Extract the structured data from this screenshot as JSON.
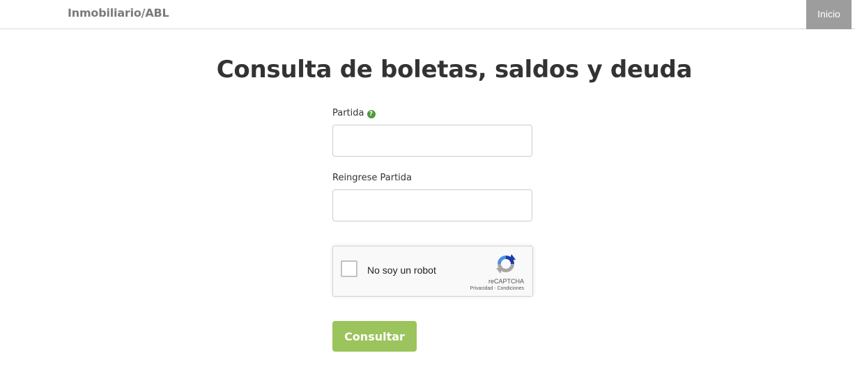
{
  "header": {
    "brand": "Inmobiliario/ABL",
    "nav_inicio": "Inicio"
  },
  "main": {
    "title": "Consulta de boletas, saldos y deuda",
    "partida_label": "Partida",
    "partida_value": "",
    "reingrese_label": "Reingrese Partida",
    "reingrese_value": "",
    "submit_label": "Consultar"
  },
  "recaptcha": {
    "label": "No soy un robot",
    "brand": "reCAPTCHA",
    "privacy": "Privacidad",
    "separator": " - ",
    "terms": "Condiciones"
  },
  "icons": {
    "help": "question-circle-icon",
    "recaptcha": "recaptcha-logo-icon"
  },
  "colors": {
    "header_button_bg": "#9d9d9d",
    "brand_text": "#7b7b7b",
    "title_text": "#333333",
    "help_icon": "#4f9a3a",
    "submit_bg": "#9bc45c"
  }
}
